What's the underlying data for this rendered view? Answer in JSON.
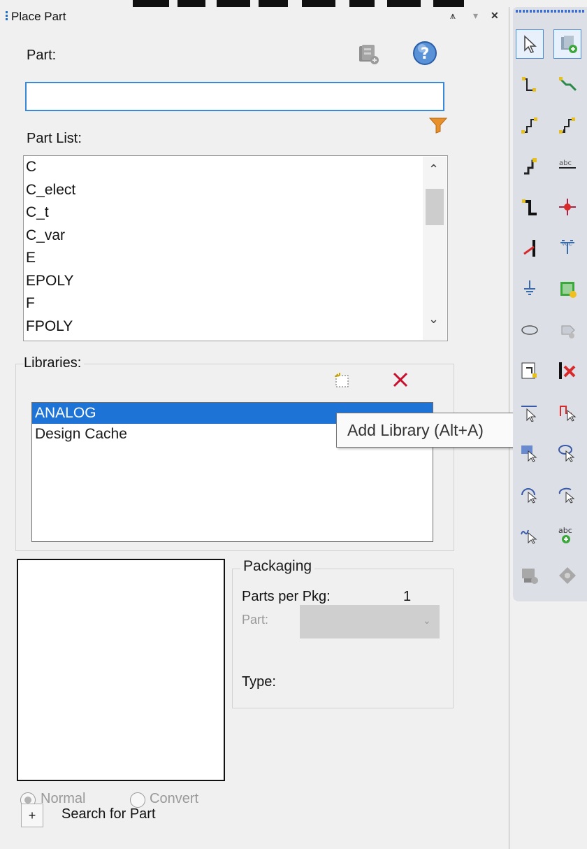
{
  "panel": {
    "title": "Place Part",
    "pin_glyph": "⩚",
    "menu_glyph": "▾",
    "close_glyph": "✕",
    "part_label": "Part:",
    "part_value": "",
    "part_list_label": "Part List:",
    "part_list_items": [
      "C",
      "C_elect",
      "C_t",
      "C_var",
      "E",
      "EPOLY",
      "F",
      "FPOLY"
    ],
    "libraries_label": "Libraries:",
    "libraries": [
      {
        "name": "ANALOG",
        "selected": true
      },
      {
        "name": "Design Cache",
        "selected": false
      }
    ],
    "tooltip": "Add Library (Alt+A)",
    "packaging": {
      "legend": "Packaging",
      "parts_per_pkg_label": "Parts per Pkg:",
      "parts_per_pkg_value": "1",
      "part_label": "Part:",
      "part_value": "",
      "type_label": "Type:"
    },
    "radio_normal": "Normal",
    "radio_convert": "Convert",
    "search_toggle": "+",
    "search_label": "Search for Part"
  },
  "icons": {
    "part_browser": "part-database-icon",
    "help": "help-icon",
    "filter": "filter-icon",
    "add_library": "add-library-icon",
    "remove_library": "remove-library-icon"
  },
  "toolbar": {
    "buttons": [
      "select-tool-icon",
      "place-part-icon",
      "place-wire-icon",
      "place-net-group-icon",
      "place-auto-wire-icon",
      "place-auto-wire-multi-icon",
      "place-auto-connect-bus-icon",
      "place-net-alias-icon",
      "place-bus-icon",
      "place-junction-icon",
      "place-bus-entry-icon",
      "place-power-icon",
      "place-ground-icon",
      "place-hierarchical-block-icon",
      "place-off-page-connector-icon",
      "place-hierarchical-port-icon",
      "place-hierarchical-pin-icon",
      "place-no-connect-icon",
      "place-line-icon",
      "place-polyline-icon",
      "place-rectangle-icon",
      "place-ellipse-icon",
      "place-arc-icon",
      "place-elliptical-arc-icon",
      "place-bezier-icon",
      "place-text-icon",
      "place-ieee-symbol-icon",
      "place-pspice-component-icon"
    ]
  },
  "colors": {
    "accent": "#1d73d6",
    "delete": "#c8102e",
    "filter": "#e8902b",
    "help": "#3d78c8"
  }
}
